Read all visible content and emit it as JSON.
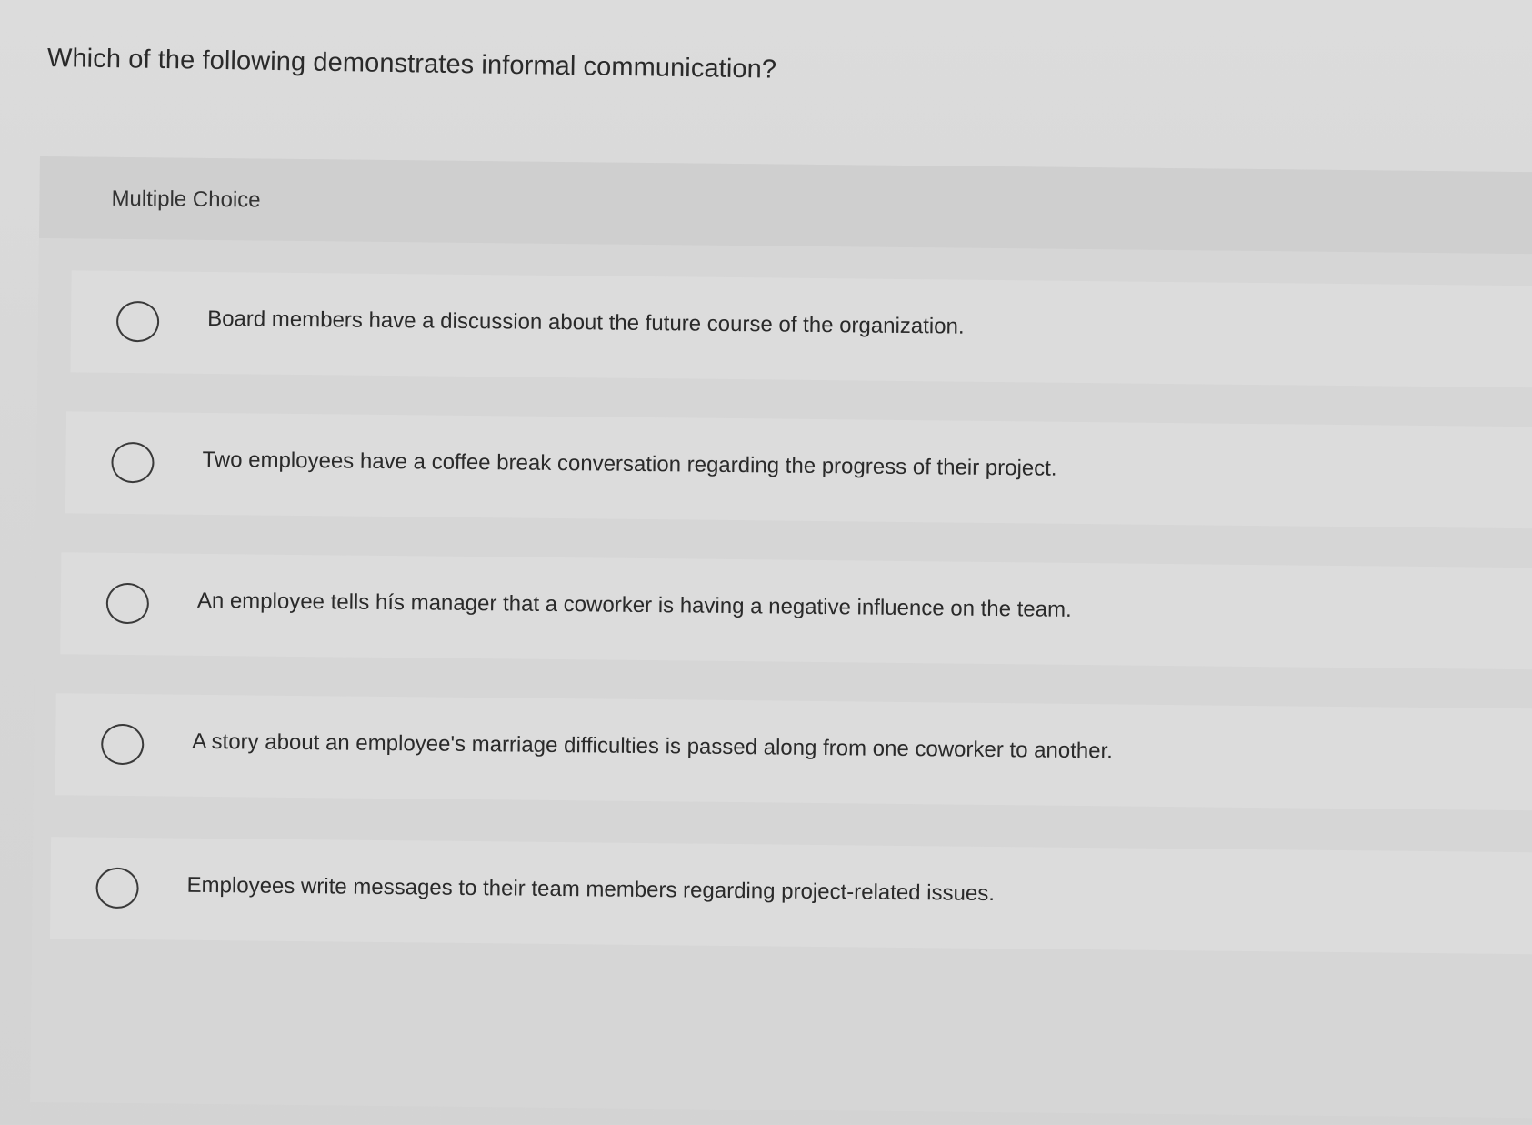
{
  "question": {
    "text": "Which of the following demonstrates informal communication?"
  },
  "panel": {
    "label": "Multiple Choice"
  },
  "options": [
    {
      "text": "Board members have a discussion about the future course of the organization."
    },
    {
      "text": "Two employees have a coffee break conversation regarding the progress of their project."
    },
    {
      "text": "An employee tells hís manager that a coworker is having a negative influence on the team."
    },
    {
      "text": "A story about an employee's marriage difficulties is passed along from one coworker to another."
    },
    {
      "text": "Employees write messages to their team members regarding project-related issues."
    }
  ],
  "icons": {
    "radio": "radio-unselected-icon"
  },
  "colors": {
    "background": "#d7d7d7",
    "option_background": "#dcdcdc",
    "text": "#2a2a2a",
    "radio_border": "#3a3a3a"
  }
}
